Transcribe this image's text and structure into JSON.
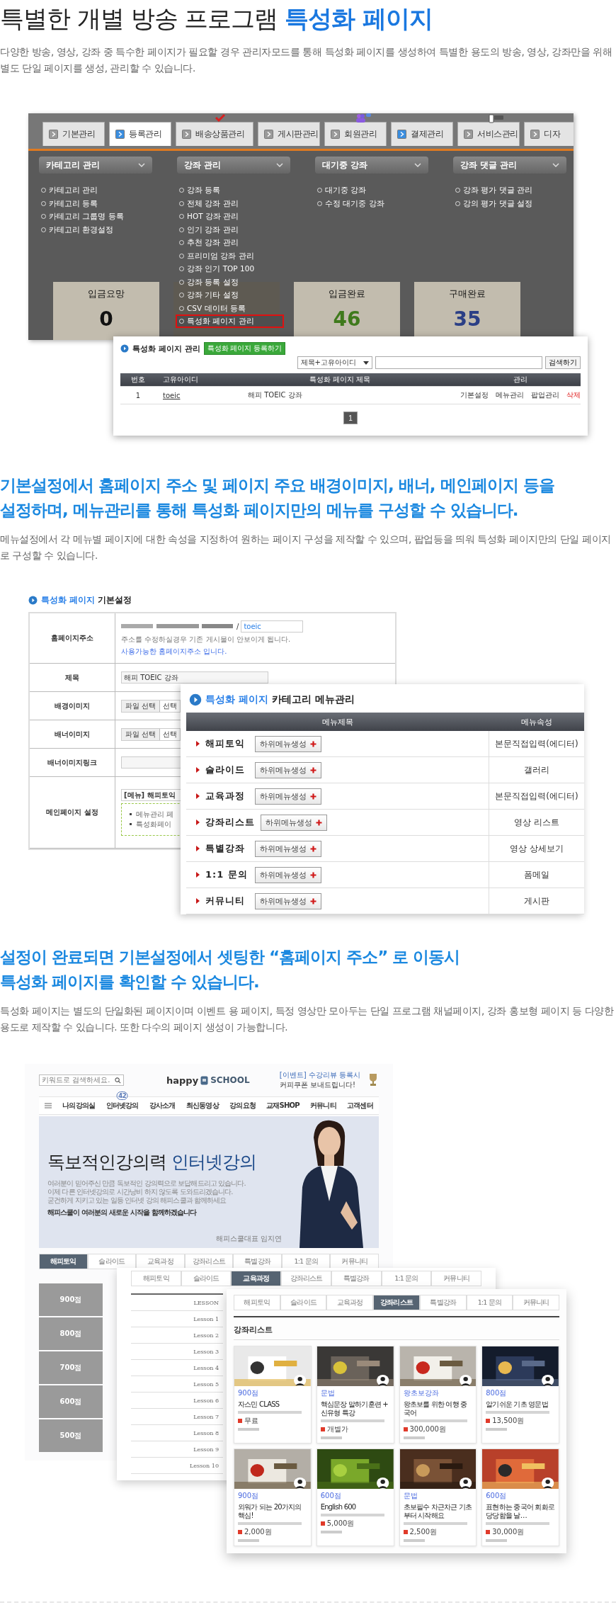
{
  "intro": {
    "title": "특별한 개별 방송 프로그램",
    "title_highlight": "특성화 페이지",
    "body": "다양한 방송, 영상, 강좌 중 특수한 페이지가 필요할 경우 관리자모드를 통해 특성화 페이지를 생성하여 특별한 용도의 방송, 영상, 강좌만을 위해 별도 단일 페이지를 생성, 관리할 수 있습니다."
  },
  "admin": {
    "tabs": [
      {
        "label": "기본관리",
        "selected": false,
        "highlighted": false,
        "kind": "plain"
      },
      {
        "label": "등록관리",
        "selected": true,
        "highlighted": true,
        "kind": "plain"
      },
      {
        "label": "배송상품관리",
        "selected": false,
        "highlighted": false,
        "kind": "check"
      },
      {
        "label": "게시판관리",
        "selected": false,
        "highlighted": false,
        "kind": "plain"
      },
      {
        "label": "회원관리",
        "selected": false,
        "highlighted": false,
        "kind": "people"
      },
      {
        "label": "결제관리",
        "selected": false,
        "highlighted": true,
        "kind": "plain"
      },
      {
        "label": "서비스관리",
        "selected": false,
        "highlighted": false,
        "kind": "tag"
      },
      {
        "label": "디자",
        "selected": false,
        "highlighted": false,
        "kind": "plain"
      }
    ],
    "menus": [
      {
        "title": "카테고리 관리",
        "items": [
          {
            "label": "카테고리 관리",
            "selected": false
          },
          {
            "label": "카테고리 등록",
            "selected": false
          },
          {
            "label": "카테고리 그룹명 등록",
            "selected": false
          },
          {
            "label": "카테고리 환경설정",
            "selected": false
          }
        ]
      },
      {
        "title": "강좌 관리",
        "items": [
          {
            "label": "강좌 등록",
            "selected": false
          },
          {
            "label": "전체 강좌 관리",
            "selected": false
          },
          {
            "label": "HOT 강좌 관리",
            "selected": false
          },
          {
            "label": "인기 강좌 관리",
            "selected": false
          },
          {
            "label": "추천 강좌 관리",
            "selected": false
          },
          {
            "label": "프리미엄 강좌 관리",
            "selected": false
          },
          {
            "label": "강좌 인기 TOP 100",
            "selected": false
          },
          {
            "label": "강좌 등록 설정",
            "selected": false
          },
          {
            "label": "강좌 기타 설정",
            "selected": false
          },
          {
            "label": "CSV 데이터 등록",
            "selected": false
          },
          {
            "label": "특성화 페이지 관리",
            "selected": true
          }
        ]
      },
      {
        "title": "대기중 강좌",
        "items": [
          {
            "label": "대기중 강좌",
            "selected": false
          },
          {
            "label": "수정 대기중 강좌",
            "selected": false
          }
        ]
      },
      {
        "title": "강좌 댓글 관리",
        "items": [
          {
            "label": "강좌 평가 댓글 관리",
            "selected": false
          },
          {
            "label": "강의 평가 댓글 설정",
            "selected": false
          }
        ]
      }
    ],
    "stats": [
      {
        "label": "입금요망",
        "value": "0",
        "color": "#111111"
      },
      {
        "label": "입금완료",
        "value": "46",
        "color": "#3f7a1c"
      },
      {
        "label": "구매완료",
        "value": "35",
        "color": "#2b3f86"
      }
    ]
  },
  "popup": {
    "title": "특성화 페이지 관리",
    "add_button": "특성화 페이지 등록하기",
    "search_select": "제목+고유아이디",
    "search_button": "검색하기",
    "columns": [
      "번호",
      "고유아이디",
      "특성화 페이지 제목",
      "관리"
    ],
    "rows": [
      {
        "no": "1",
        "id": "toeic",
        "title": "해피 TOEIC 강좌",
        "actions": [
          {
            "label": "기본설정",
            "kind": "link"
          },
          {
            "label": "메뉴관리",
            "kind": "link"
          },
          {
            "label": "팝업관리",
            "kind": "link"
          },
          {
            "label": "삭제",
            "kind": "danger"
          }
        ]
      }
    ],
    "pages": [
      {
        "label": "1",
        "selected": true
      }
    ]
  },
  "section2": {
    "title_lines": [
      "기본설정에서 홈페이지 주소 및 페이지 주요 배경이미지, 배너, 메인페이지 등을",
      "설정하며, 메뉴관리를 통해 특성화 페이지만의 메뉴를 구성할 수 있습니다."
    ],
    "body": "메뉴설정에서 각 메뉴별 페이지에 대한 속성을 지정하여 원하는 페이지 구성을 제작할 수 있으며, 팝업등을 띄워 특성화 페이지만의 단일 페이지로 구성할 수 있습니다."
  },
  "settings": {
    "title": "특성화 페이지",
    "title_rest": "기본설정",
    "rows": [
      {
        "label": "홈페이지주소",
        "kind": "address",
        "separator": "/",
        "value": "toeic",
        "notes": [
          {
            "text": "주소를 수정하실경우 기존 게시물이 안보이게 됩니다.",
            "kind": "note"
          },
          {
            "text": "사용가능한 홈페이지주소 입니다.",
            "kind": "ok"
          }
        ]
      },
      {
        "label": "제목",
        "kind": "text",
        "value": "해피 TOEIC 강좌"
      },
      {
        "label": "배경이미지",
        "kind": "file",
        "button": "파일 선택",
        "value": "선택"
      },
      {
        "label": "배너이미지",
        "kind": "file",
        "button": "파일 선택",
        "value": "선택"
      },
      {
        "label": "배너이미지링크",
        "kind": "text"
      },
      {
        "label": "메인페이지 설정",
        "kind": "main",
        "value": "[메뉴] 해피토익",
        "bullets": [
          "메뉴관리 페",
          "특성화페이"
        ]
      }
    ]
  },
  "menu_panel": {
    "title": "특성화 페이지",
    "title_rest": "카테고리 메뉴관리",
    "columns": [
      "메뉴제목",
      "메뉴속성"
    ],
    "rows": [
      {
        "name": "해피토익",
        "button": "하위메뉴생성",
        "attribute": "본문직접입력(에디터)"
      },
      {
        "name": "슬라이드",
        "button": "하위메뉴생성",
        "attribute": "갤러리"
      },
      {
        "name": "교육과정",
        "button": "하위메뉴생성",
        "attribute": "본문직접입력(에디터)"
      },
      {
        "name": "강좌리스트",
        "button": "하위메뉴생성",
        "attribute": "영상 리스트"
      },
      {
        "name": "특별강좌",
        "button": "하위메뉴생성",
        "attribute": "영상 상세보기"
      },
      {
        "name": "1:1 문의",
        "button": "하위메뉴생성",
        "attribute": "폼메일"
      },
      {
        "name": "커뮤니티",
        "button": "하위메뉴생성",
        "attribute": "게시판"
      }
    ]
  },
  "section3": {
    "title_lines": [
      "설정이 완료되면 기본설정에서 셋팅한 “홈페이지 주소” 로 이동시",
      "특성화 페이지를 확인할 수 있습니다."
    ],
    "body": "특성화 페이지는 별도의 단일화된 페이지이며 이벤트 용 페이지, 특정 영상만 모아두는 단일 프로그램 채널페이지, 강좌 홍보형 페이지 등 다양한 용도로 제작할 수 있습니다. 또한 다수의 페이지 생성이 가능합니다."
  },
  "site": {
    "search_placeholder": "키워드로 검색하세요.",
    "logo_word": "happy",
    "logo_name": "SCHOOL",
    "event_lines": [
      "[이벤트] 수강리뷰 등록시",
      "커피쿠폰 보내드립니다!"
    ],
    "nav": [
      {
        "label": "나의강의실"
      },
      {
        "label": "인터넷강의",
        "badge": "42"
      },
      {
        "label": "강사소개"
      },
      {
        "label": "최신동영상"
      },
      {
        "label": "강의요청"
      },
      {
        "label": "교재SHOP"
      },
      {
        "label": "커뮤니티"
      },
      {
        "label": "고객센터"
      }
    ],
    "banner": {
      "headline": "독보적인강의력",
      "headline_highlight": "인터넷강의",
      "lines": [
        "여러분이 믿어주신 만큼 독보적인 강의력으로 보답해드리고 있습니다.",
        "이제 다른 인터넷강의로 시간낭비 하지 않도록 도와드리겠습니다.",
        "굳건하게 지키고 있는 일등 인터넷 강의 해피스쿨과 함께하세요"
      ],
      "tagline": "해피스쿨이 여러분의 새로운 시작을 함께하겠습니다",
      "caption": "해피스쿨대표 임지연"
    },
    "tabs": [
      {
        "label": "해피토익",
        "selected": true
      },
      {
        "label": "슬라이드",
        "selected": false
      },
      {
        "label": "교육과정",
        "selected": false
      },
      {
        "label": "강좌리스트",
        "selected": false
      },
      {
        "label": "특별강좌",
        "selected": false
      },
      {
        "label": "1:1 문의",
        "selected": false
      },
      {
        "label": "커뮤니티",
        "selected": false
      }
    ],
    "score_boxes": [
      "900점",
      "800점",
      "700점",
      "600점",
      "500점"
    ]
  },
  "lesson_page": {
    "tabs": [
      {
        "label": "해피토익",
        "selected": false
      },
      {
        "label": "슬라이드",
        "selected": false
      },
      {
        "label": "교육과정",
        "selected": true
      },
      {
        "label": "강좌리스트",
        "selected": false
      },
      {
        "label": "특별강좌",
        "selected": false
      },
      {
        "label": "1:1 문의",
        "selected": false
      },
      {
        "label": "커뮤니티",
        "selected": false
      }
    ],
    "header": "LESSON",
    "lessons": [
      "Lesson 1",
      "Lesson 2",
      "Lesson 3",
      "Lesson 4",
      "Lesson 5",
      "Lesson 6",
      "Lesson 7",
      "Lesson 8",
      "Lesson 9",
      "Lesson 10"
    ]
  },
  "course_page": {
    "tabs": [
      {
        "label": "해피토익",
        "selected": false
      },
      {
        "label": "슬라이드",
        "selected": false
      },
      {
        "label": "교육과정",
        "selected": false
      },
      {
        "label": "강좌리스트",
        "selected": true
      },
      {
        "label": "특별강좌",
        "selected": false
      },
      {
        "label": "1:1 문의",
        "selected": false
      },
      {
        "label": "커뮤니티",
        "selected": false
      }
    ],
    "heading": "강좌리스트",
    "courses": [
      {
        "level": "900점",
        "title": "자스민 CLASS",
        "price": "무료"
      },
      {
        "level": "문법",
        "title": "핵심문장 말하기훈련 + 신유형 특강",
        "price": "개별가"
      },
      {
        "level": "왕초보강좌",
        "title": "왕초보를 위한 여행 중국어",
        "price": "300,000원"
      },
      {
        "level": "800점",
        "title": "알기쉬운 기초 영문법",
        "price": "13,500원"
      },
      {
        "level": "900점",
        "title": "외워가 되는 20가지의 핵심!",
        "price": "2,000원"
      },
      {
        "level": "600점",
        "title": "English 600",
        "price": "5,000원"
      },
      {
        "level": "문법",
        "title": "초보필수 차근차근 기초부터 시작해요",
        "price": "2,500원"
      },
      {
        "level": "600점",
        "title": "표현하는 중국어 회화로 당당함을 날…",
        "price": "30,000원"
      }
    ]
  }
}
